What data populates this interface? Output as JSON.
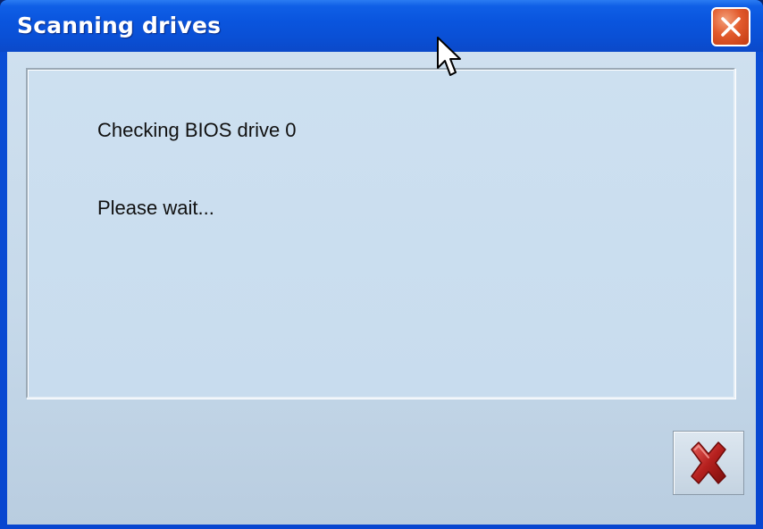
{
  "window": {
    "title": "Scanning drives"
  },
  "titlebar": {
    "close_icon": "close-icon"
  },
  "content": {
    "status_line": "Checking BIOS drive 0",
    "wait_line": "Please wait..."
  },
  "actions": {
    "cancel_icon": "red-x-icon"
  },
  "colors": {
    "titlebar": "#0a55de",
    "client": "#c8dcee",
    "close_button": "#e25a2c",
    "cancel_x": "#b5201e"
  }
}
